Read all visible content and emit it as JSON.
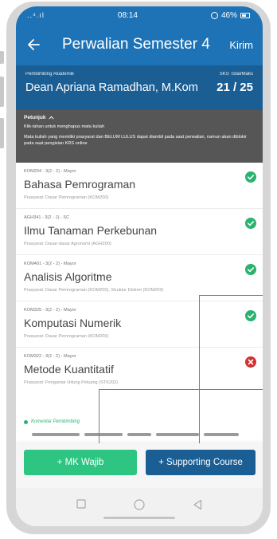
{
  "status_bar": {
    "signal": "..⁴.ıl",
    "time": "08:14",
    "battery": "46%"
  },
  "app_bar": {
    "title": "Perwalian Semester 4",
    "action": "Kirim"
  },
  "info": {
    "advisor_label": "Pembimbing Akademik",
    "advisor_name": "Dean Apriana Ramadhan, M.Kom",
    "sks_label": "SKS Total/Maks",
    "sks_value": "21  /  25"
  },
  "instructions": {
    "title": "Petunjuk",
    "line1": "Klik-tahan untuk menghapus mata kuliah",
    "line2": "Mata kuliah yang memiliki prasyarat dan BELUM LULUS dapat diambil pada saat perwalian, namun akan diblokir pada saat pengisian KRS online"
  },
  "courses": [
    {
      "code": "KOM204 - 3(2 - 2) - Mayor",
      "name": "Bahasa Pemrograman",
      "prereq": "Prasyarat: Dasar Pemrograman (KOM200)",
      "status": "ok"
    },
    {
      "code": "AGH341 - 3(2 - 1) - SC",
      "name": "Ilmu Tanaman Perkebunan",
      "prereq": "Prasyarat: Dasar-dasar Agronomi (AGH200)",
      "status": "ok"
    },
    {
      "code": "KOM401 - 3(2 - 2) - Mayor",
      "name": "Analisis Algoritme",
      "prereq": "Prasyarat: Dasar Pemrograman (KOM200), Struktur Diskret (KOM209)",
      "status": "ok"
    },
    {
      "code": "KOM325 - 3(2 - 2) - Mayor",
      "name": "Komputasi Numerik",
      "prereq": "Prasyarat: Dasar Pemrograman (KOM200)",
      "status": "ok"
    },
    {
      "code": "KOM322 - 3(2 - 2) - Mayor",
      "name": "Metode Kuantitatif",
      "prereq": "Prasyarat: Pengantar Hitung Peluang (STK202)",
      "status": "blocked"
    }
  ],
  "comment": {
    "label": "Komentar Pembimbing"
  },
  "buttons": {
    "mk_wajib": "+ MK Wajib",
    "supporting": "+ Supporting Course"
  },
  "colors": {
    "primary": "#1e73b6",
    "primary_dark": "#1a5e94",
    "accent": "#2ec583",
    "ok": "#2bb36e",
    "error": "#d33030"
  }
}
